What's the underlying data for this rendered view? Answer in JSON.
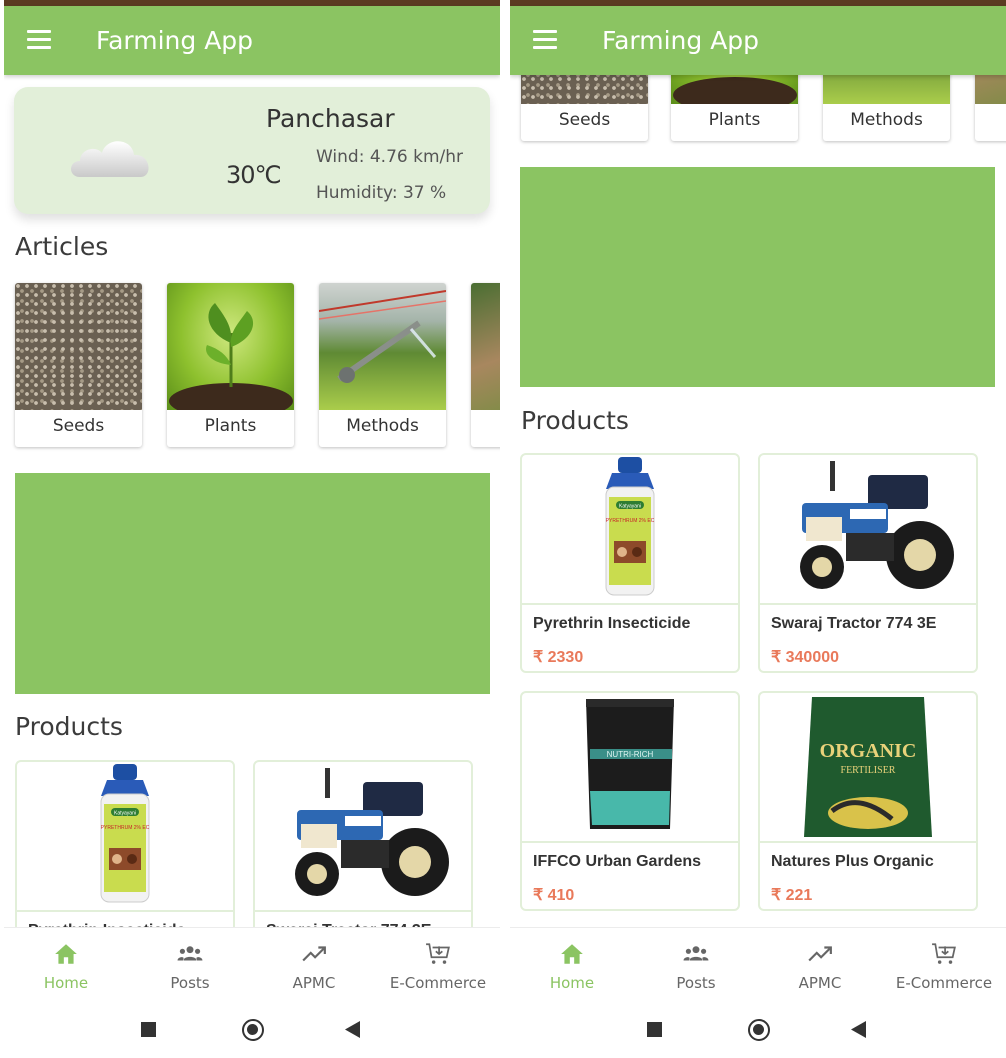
{
  "app": {
    "title": "Farming App"
  },
  "weather": {
    "city": "Panchasar",
    "temperature": "30℃",
    "wind": "Wind: 4.76 km/hr",
    "humidity": "Humidity: 37 %",
    "icon": "cloud-icon"
  },
  "sections": {
    "articles": "Articles",
    "products": "Products"
  },
  "articles": [
    {
      "label": "Seeds"
    },
    {
      "label": "Plants"
    },
    {
      "label": "Methods"
    }
  ],
  "products": [
    {
      "name": "Pyrethrin Insecticide",
      "price": "₹ 2330"
    },
    {
      "name": "Swaraj Tractor 774 3E",
      "price": "₹ 340000"
    },
    {
      "name": "IFFCO Urban Gardens",
      "price": "₹ 410"
    },
    {
      "name": "Natures Plus Organic",
      "price": "₹ 221"
    }
  ],
  "product_label_text": {
    "bottle": "Katyayani",
    "bottle_label": "PYRETHRUM 2% EC",
    "bag1": "NUTRI-RICH",
    "bag2": "ORGANIC",
    "bag2_sub": "FERTILISER"
  },
  "bottom_nav": [
    {
      "label": "Home",
      "icon": "home-icon",
      "active": true
    },
    {
      "label": "Posts",
      "icon": "people-icon",
      "active": false
    },
    {
      "label": "APMC",
      "icon": "trending-up-icon",
      "active": false
    },
    {
      "label": "E-Commerce",
      "icon": "cart-icon",
      "active": false
    }
  ],
  "colors": {
    "primary": "#8bc462",
    "card_bg": "#e2efd9",
    "price": "#e9795a",
    "status_bar": "#5b3b22"
  }
}
